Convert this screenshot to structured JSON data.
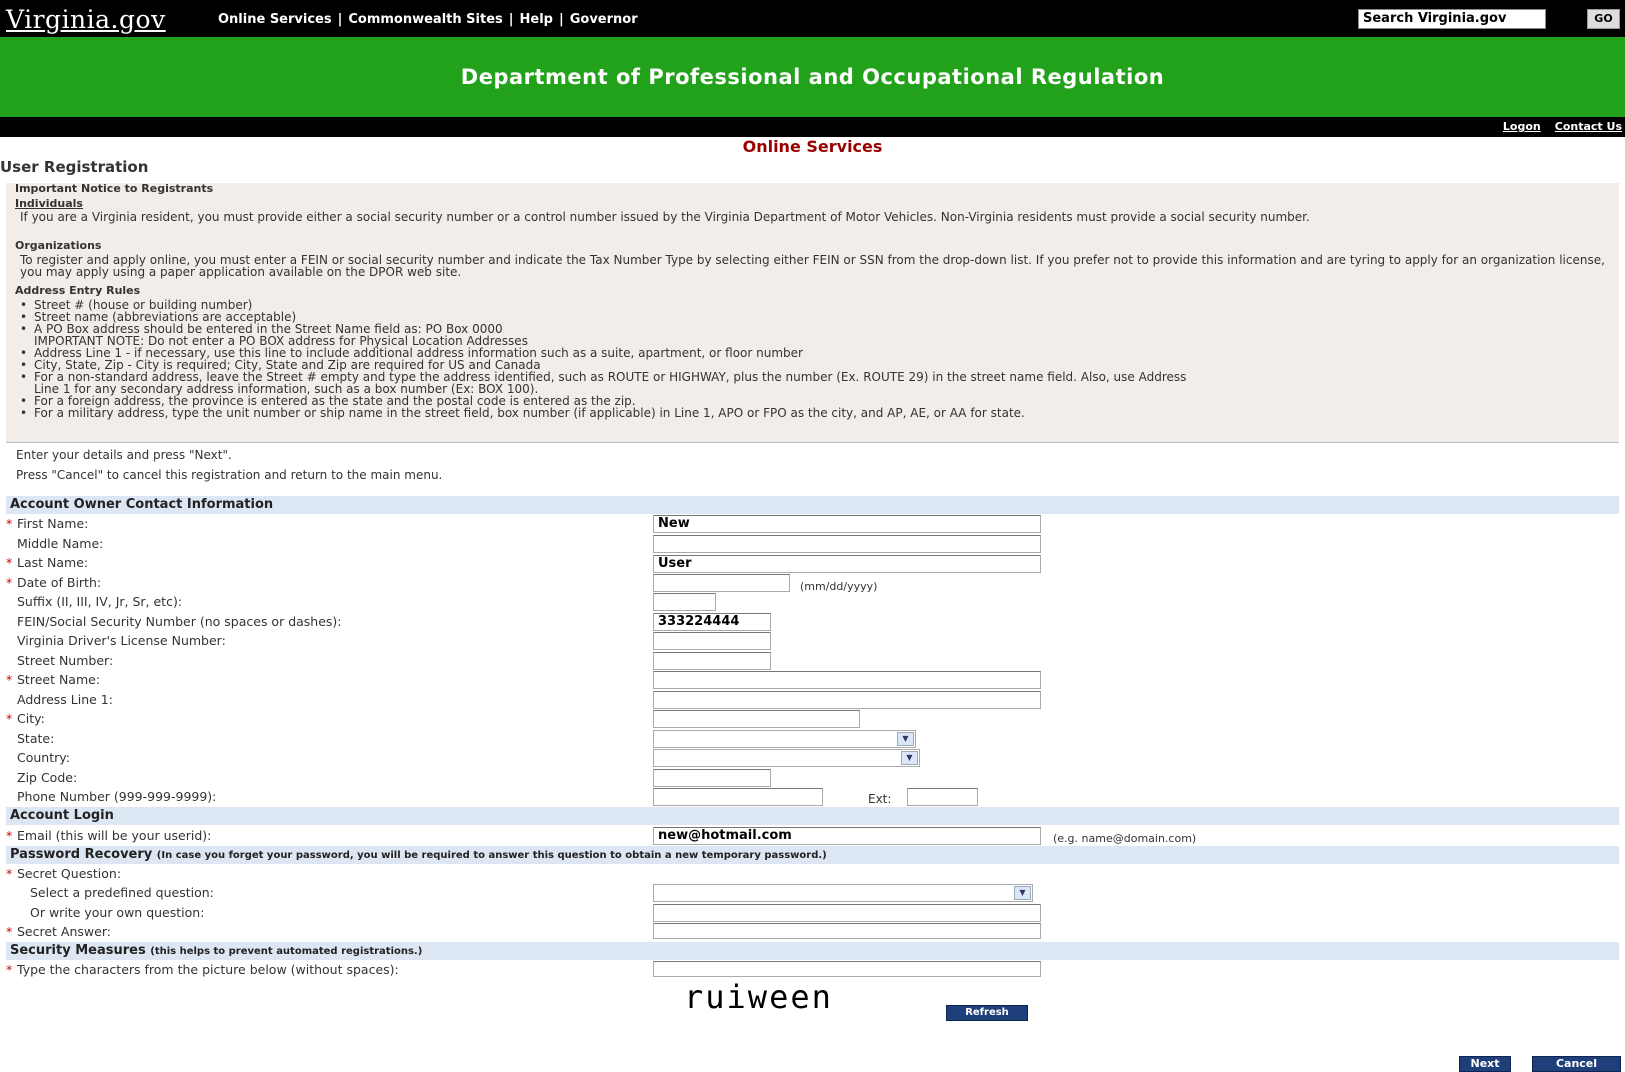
{
  "header": {
    "logo": "Virginia.gov",
    "nav": [
      "Online Services",
      "Commonwealth Sites",
      "Help",
      "Governor"
    ],
    "search_placeholder": "Search Virginia.gov",
    "go_label": "GO"
  },
  "banner": {
    "title": "Department of Professional and Occupational Regulation"
  },
  "toplinks": {
    "logon": "Logon",
    "contact": "Contact Us"
  },
  "section_title": "Online Services",
  "page_title": "User Registration",
  "notice": {
    "heading": "Important Notice to Registrants",
    "individuals_heading": "Individuals",
    "individuals_text": "If you are a Virginia resident, you must provide either a social security number or a control number issued by the Virginia Department of Motor Vehicles. Non-Virginia residents must provide a social security number.",
    "organizations_heading": "Organizations",
    "organizations_text": "To register and apply online, you must enter a FEIN or social security number and indicate the Tax Number Type by selecting either FEIN or SSN from the drop-down list. If you prefer not to provide this information and are tyring to apply for an organization license, you may apply using a paper application available on the DPOR web site.",
    "address_heading": "Address Entry Rules",
    "rules": [
      "Street # (house or building number)",
      "Street name (abbreviations are acceptable)",
      "A PO Box address should be entered in the Street Name field as: PO Box 0000",
      "IMPORTANT NOTE: Do not enter a PO BOX address for Physical Location Addresses",
      "Address Line 1 - if necessary, use this line to include additional address information such as a suite, apartment, or floor number",
      "City, State, Zip - City is required; City, State and Zip are required for US and Canada",
      "For a non-standard address, leave the Street # empty and type the address identified, such as ROUTE or HIGHWAY, plus the number (Ex. ROUTE 29) in the street name field. Also, use Address",
      "Line 1 for any secondary address information, such as a box number (Ex: BOX 100).",
      "For a foreign address, the province is entered as the state and the postal code is entered as the zip.",
      "For a military address, type the unit number or ship name in the street field, box number (if applicable) in Line 1, APO or FPO as the city, and AP, AE, or AA for state."
    ]
  },
  "instructions": {
    "line1": "Enter your details and press \"Next\".",
    "line2": "Press \"Cancel\" to cancel this registration and return to the main menu."
  },
  "contact": {
    "heading": "Account Owner Contact Information",
    "first_name_label": "First Name:",
    "first_name": "New",
    "middle_name_label": "Middle Name:",
    "middle_name": "",
    "last_name_label": "Last Name:",
    "last_name": "User",
    "dob_label": "Date of Birth:",
    "dob": "",
    "dob_hint": "(mm/dd/yyyy)",
    "suffix_label": "Suffix (II, III, IV, Jr, Sr, etc):",
    "suffix": "",
    "fein_label": "FEIN/Social Security Number (no spaces or dashes):",
    "fein": "333224444",
    "dl_label": "Virginia Driver's License Number:",
    "dl": "",
    "street_number_label": "Street Number:",
    "street_number": "",
    "street_name_label": "Street Name:",
    "street_name": "",
    "address1_label": "Address Line 1:",
    "address1": "",
    "city_label": "City:",
    "city": "",
    "state_label": "State:",
    "state": "",
    "country_label": "Country:",
    "country": "",
    "zip_label": "Zip Code:",
    "zip": "",
    "phone_label": "Phone Number (999-999-9999):",
    "phone": "",
    "ext_label": "Ext:",
    "ext": ""
  },
  "login": {
    "heading": "Account Login",
    "email_label": "Email (this will be your userid):",
    "email": "new@hotmail.com",
    "email_hint": "(e.g. name@domain.com)"
  },
  "recovery": {
    "heading": "Password Recovery",
    "note": "(In case you forget your password, you will be required to answer this question to obtain a new temporary password.)",
    "question_label": "Secret Question:",
    "predefined_label": "Select a predefined question:",
    "own_label": "Or write your own question:",
    "answer_label": "Secret Answer:"
  },
  "security": {
    "heading": "Security Measures",
    "note": "(this helps to prevent automated registrations.)",
    "prompt": "Type the characters from the picture below (without spaces):",
    "captcha": "ruiween",
    "refresh": "Refresh"
  },
  "buttons": {
    "next": "Next",
    "cancel": "Cancel"
  },
  "colors": {
    "green": "#22a11a",
    "dark_red": "#990000",
    "section_blue": "#dde6f3",
    "button_navy": "#1f3f7a"
  }
}
